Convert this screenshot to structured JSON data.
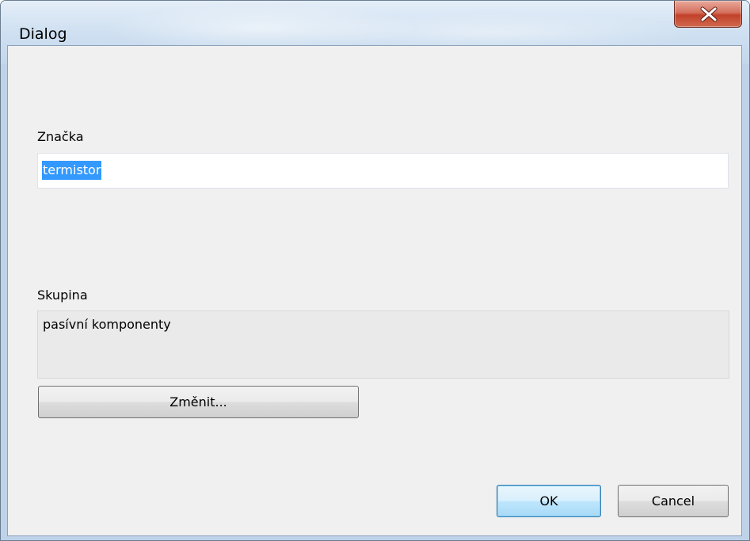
{
  "window": {
    "title": "Dialog",
    "close_label": "X"
  },
  "form": {
    "znacka_label": "Značka",
    "znacka_value": "termistor",
    "skupina_label": "Skupina",
    "skupina_value": "pasívní komponenty",
    "change_button": "Změnit..."
  },
  "buttons": {
    "ok": "OK",
    "cancel": "Cancel"
  },
  "colors": {
    "selection": "#3399ff",
    "close_button": "#c2412a",
    "client_background": "#f0f0f0"
  }
}
